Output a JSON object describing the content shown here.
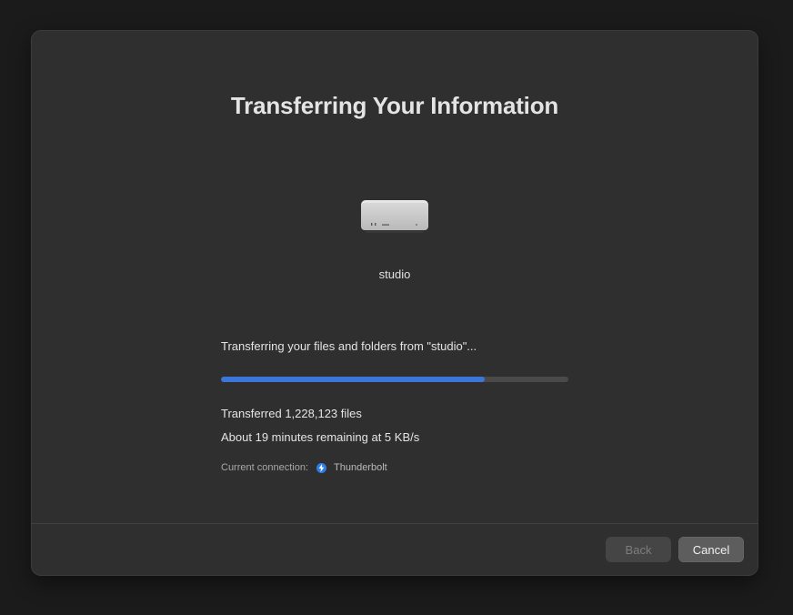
{
  "window": {
    "title": "Transferring Your Information"
  },
  "device": {
    "icon": "mac-studio-icon",
    "name": "studio"
  },
  "transfer": {
    "status": "Transferring your files and folders from \"studio\"...",
    "progress_percent": 76,
    "transferred": "Transferred 1,228,123 files",
    "remaining": "About 19 minutes remaining at 5 KB/s",
    "connection_label": "Current connection:",
    "connection_value": "Thunderbolt",
    "connection_icon": "thunderbolt-icon"
  },
  "buttons": {
    "back_label": "Back",
    "cancel_label": "Cancel"
  },
  "colors": {
    "progress": "#3b76d8",
    "connection_icon": "#2f7ee6"
  }
}
